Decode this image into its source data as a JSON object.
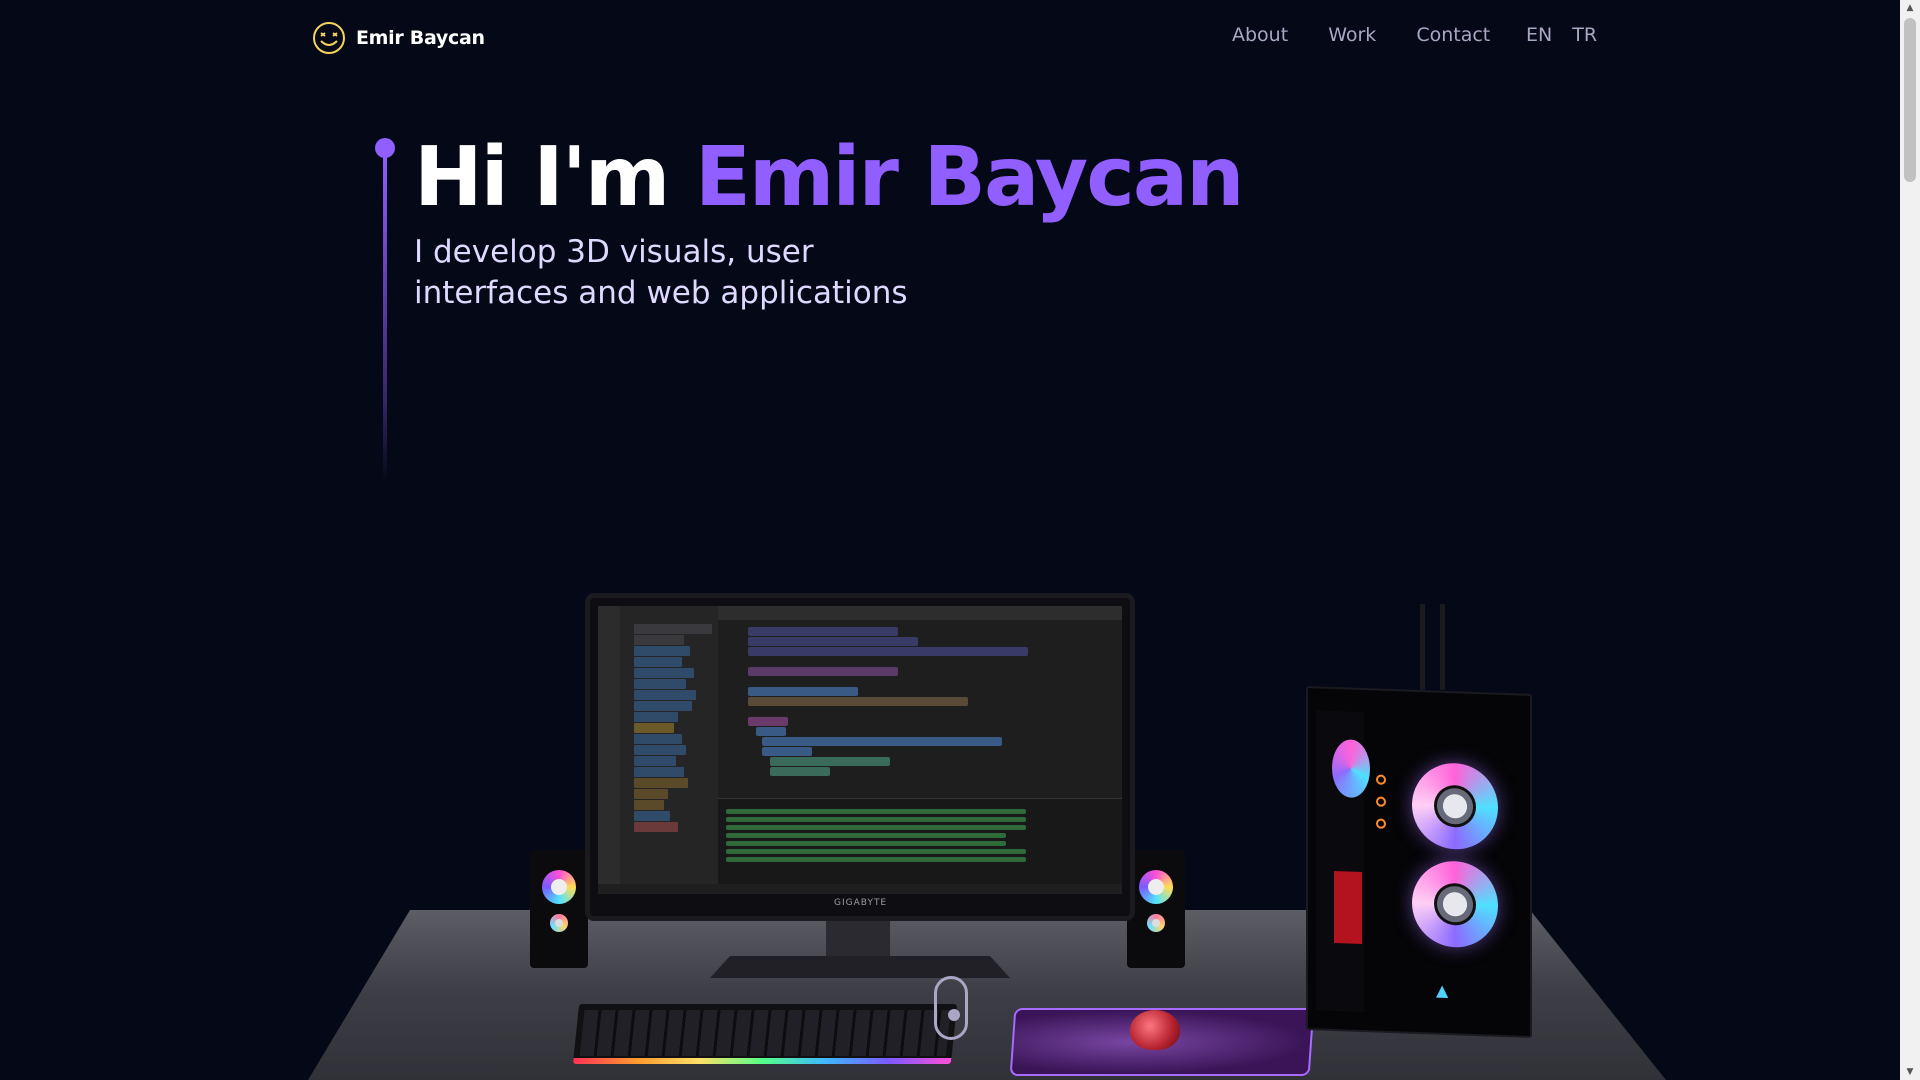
{
  "brand": {
    "name": "Emir Baycan",
    "logo_icon": "smiley-face-icon"
  },
  "nav": {
    "links": [
      {
        "label": "About"
      },
      {
        "label": "Work"
      },
      {
        "label": "Contact"
      }
    ],
    "languages": [
      {
        "label": "EN"
      },
      {
        "label": "TR"
      }
    ]
  },
  "hero": {
    "greeting": "Hi I'm ",
    "name": "Emir Baycan",
    "subtitle_line1": "I develop 3D visuals, user",
    "subtitle_line2": "interfaces and web applications"
  },
  "scene": {
    "monitor_brand": "GIGABYTE",
    "accent_color": "#915eff",
    "background_color": "#050816"
  },
  "scroll_hint_icon": "mouse-scroll-icon"
}
